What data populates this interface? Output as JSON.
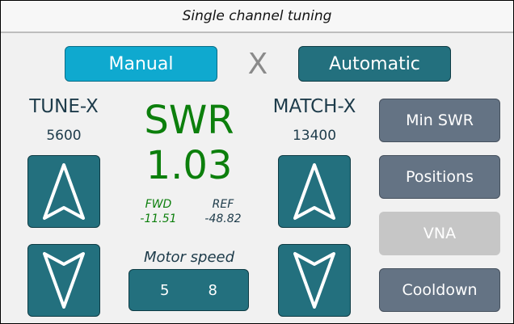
{
  "title": "Single channel tuning",
  "mode": {
    "manual_label": "Manual",
    "separator": "X",
    "automatic_label": "Automatic"
  },
  "tune": {
    "label": "TUNE-X",
    "value": "5600"
  },
  "match": {
    "label": "MATCH-X",
    "value": "13400"
  },
  "swr": {
    "label": "SWR",
    "value": "1.03",
    "fwd_label": "FWD",
    "fwd_value": "-11.51",
    "ref_label": "REF",
    "ref_value": "-48.82"
  },
  "motor_speed": {
    "label": "Motor speed",
    "left": "5",
    "right": "8"
  },
  "side_buttons": {
    "min_swr": "Min SWR",
    "positions": "Positions",
    "vna": "VNA",
    "cooldown": "Cooldown"
  },
  "colors": {
    "teal": "#23707e",
    "active": "#0fa9cf",
    "grey": "#647384",
    "swr_green": "#0c7f0c"
  },
  "icons": {
    "up": "up-arrow-icon",
    "down": "down-arrow-icon"
  }
}
